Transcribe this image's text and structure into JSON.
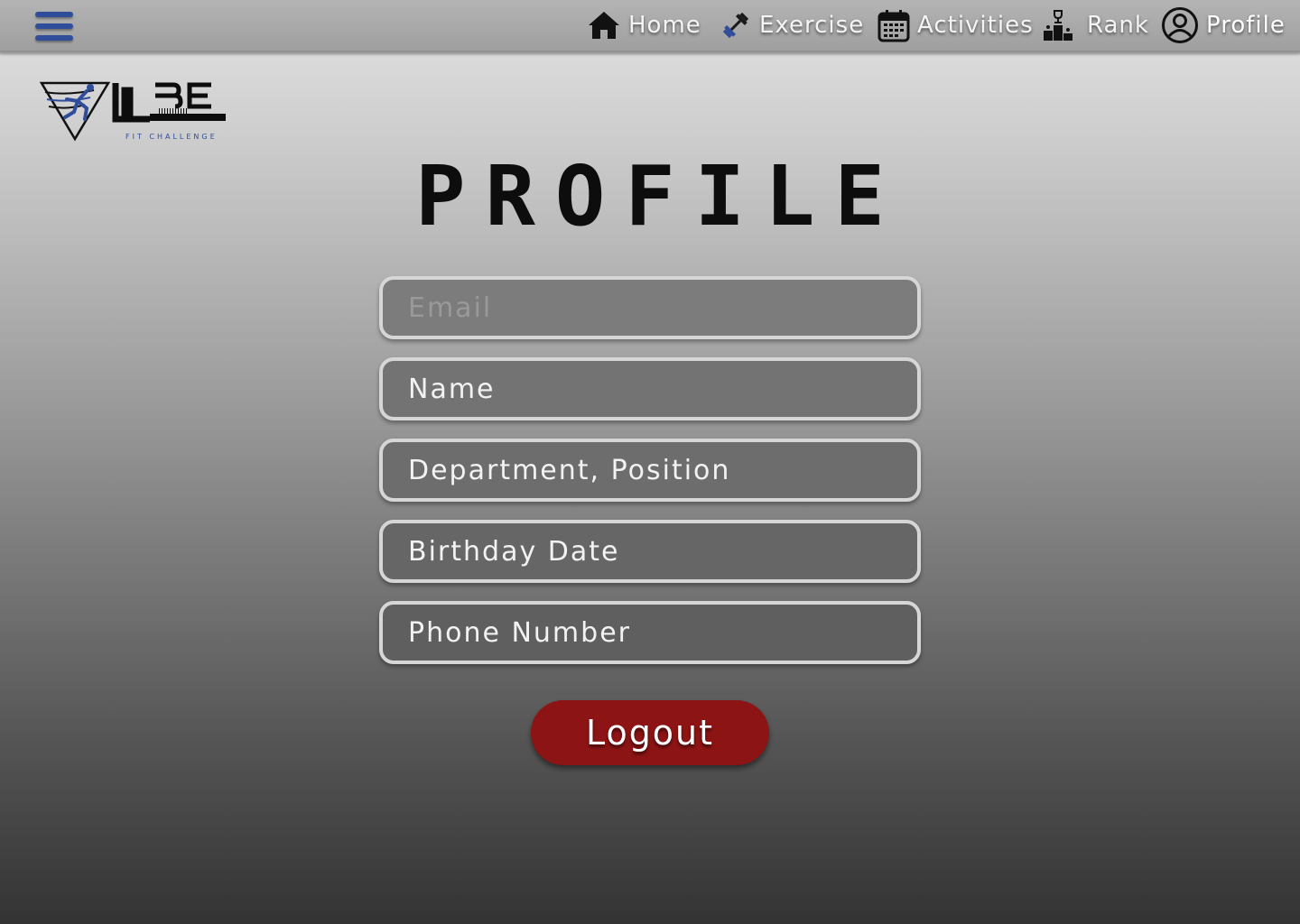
{
  "nav": {
    "items": [
      {
        "label": "Home",
        "icon": "home-icon"
      },
      {
        "label": "Exercise",
        "icon": "dumbbell-icon"
      },
      {
        "label": "Activities",
        "icon": "calendar-icon"
      },
      {
        "label": "Rank",
        "icon": "podium-icon"
      },
      {
        "label": "Profile",
        "icon": "user-circle-icon",
        "active": true
      }
    ],
    "menu_icon": "hamburger-menu-icon"
  },
  "logo": {
    "wordmark": "UBE",
    "tagline": "FIT CHALLENGE"
  },
  "page": {
    "title": "PROFILE"
  },
  "form": {
    "email_placeholder": "Email",
    "name_placeholder": "Name",
    "department_placeholder": "Department, Position",
    "birthday_placeholder": "Birthday Date",
    "phone_placeholder": "Phone Number"
  },
  "actions": {
    "logout_label": "Logout"
  },
  "colors": {
    "accent_blue": "#2f4d9a",
    "logout_red": "#8d1414",
    "nav_bar": "#a8a8a8"
  }
}
